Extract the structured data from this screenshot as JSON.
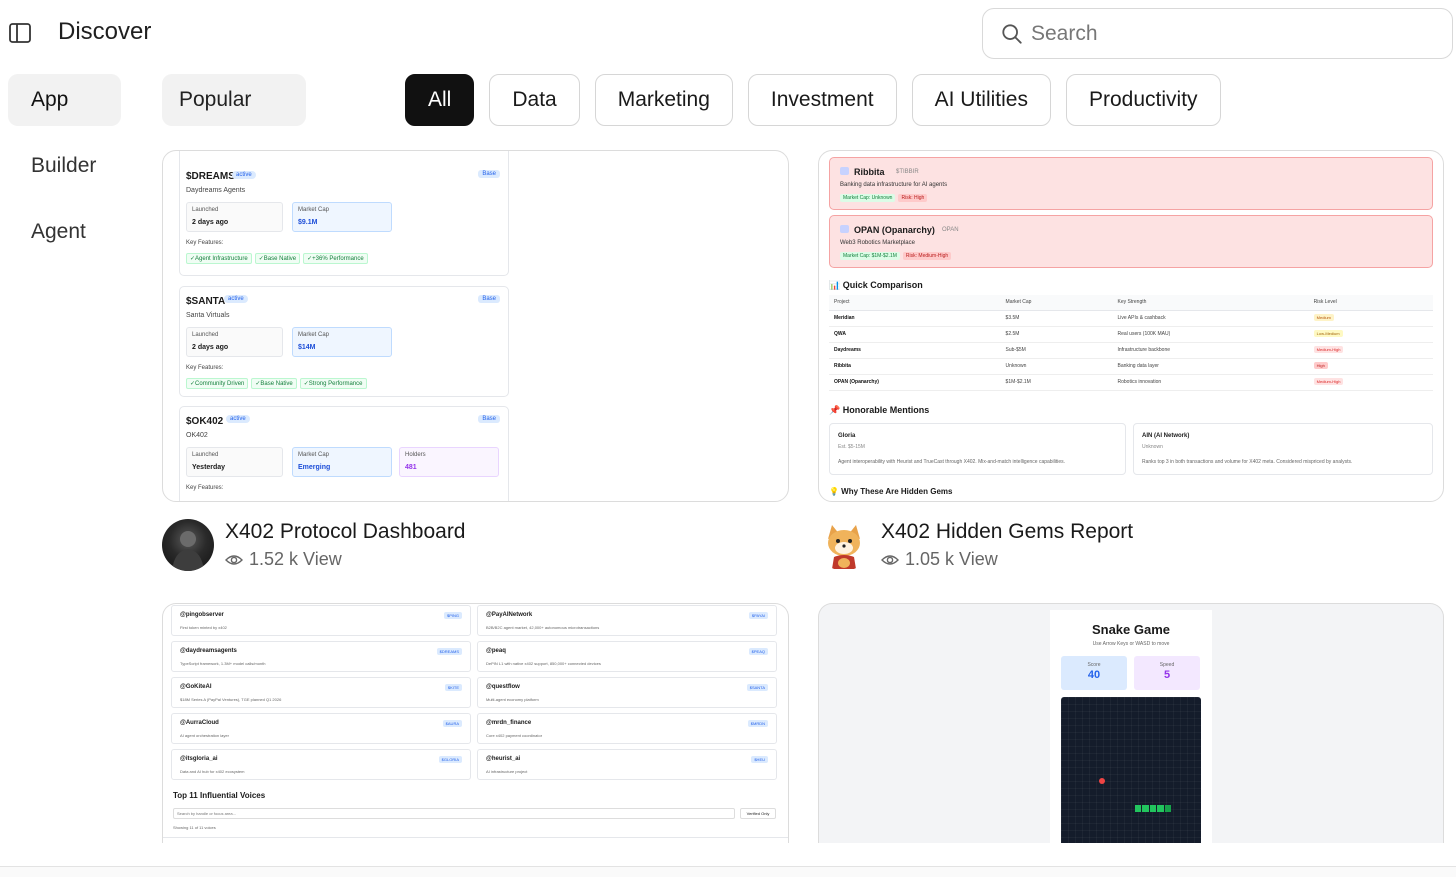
{
  "header": {
    "title": "Discover",
    "search_placeholder": "Search"
  },
  "nav": {
    "items": [
      {
        "label": "App"
      },
      {
        "label": "Builder"
      },
      {
        "label": "Agent"
      }
    ]
  },
  "sort": {
    "selected": "Popular"
  },
  "filters": [
    {
      "label": "All"
    },
    {
      "label": "Data"
    },
    {
      "label": "Marketing"
    },
    {
      "label": "Investment"
    },
    {
      "label": "AI Utilities"
    },
    {
      "label": "Productivity"
    }
  ],
  "cards": [
    {
      "title": "X402 Protocol Dashboard",
      "views": "1.52 k View",
      "preview": {
        "tokens": [
          {
            "symbol": "$DREAMS",
            "status": "active",
            "chain": "Base",
            "name": "Daydreams Agents",
            "launched_label": "Launched",
            "launched": "2 days ago",
            "mcap_label": "Market Cap",
            "mcap": "$9.1M",
            "features_label": "Key Features:",
            "features": [
              "✓Agent Infrastructure",
              "✓Base Native",
              "✓+36% Performance"
            ]
          },
          {
            "symbol": "$SANTA",
            "status": "active",
            "chain": "Base",
            "name": "Santa Virtuals",
            "launched_label": "Launched",
            "launched": "2 days ago",
            "mcap_label": "Market Cap",
            "mcap": "$14M",
            "features_label": "Key Features:",
            "features": [
              "✓Community Driven",
              "✓Base Native",
              "✓Strong Performance"
            ]
          },
          {
            "symbol": "$OK402",
            "status": "active",
            "chain": "Base",
            "name": "OK402",
            "launched_label": "Launched",
            "launched": "Yesterday",
            "mcap_label": "Market Cap",
            "mcap": "Emerging",
            "holders_label": "Holders",
            "holders": "481",
            "features_label": "Key Features:"
          }
        ]
      }
    },
    {
      "title": "X402 Hidden Gems Report",
      "views": "1.05 k View",
      "preview": {
        "risk_cards": [
          {
            "name": "Ribbita",
            "ticker": "$TIBBIR",
            "desc": "Banking data infrastructure for AI agents",
            "tags": [
              "Market Cap: Unknown",
              "Risk: High"
            ]
          },
          {
            "name": "OPAN (Opanarchy)",
            "ticker": "OPAN",
            "desc": "Web3 Robotics Marketplace",
            "tags": [
              "Market Cap: $1M-$2.1M",
              "Risk: Medium-High"
            ]
          }
        ],
        "comparison_title": "📊 Quick Comparison",
        "comparison_headers": [
          "Project",
          "Market Cap",
          "Key Strength",
          "Risk Level"
        ],
        "comparison_rows": [
          [
            "Meridian",
            "$3.5M",
            "Live APIs & cashback",
            "Medium"
          ],
          [
            "QWA",
            "$2.5M",
            "Real users (100K MAU)",
            "Low-Medium"
          ],
          [
            "Daydreams",
            "Sub-$5M",
            "Infrastructure backbone",
            "Medium-High"
          ],
          [
            "Ribbita",
            "Unknown",
            "Banking data layer",
            "High"
          ],
          [
            "OPAN (Opanarchy)",
            "$1M-$2.1M",
            "Robotics innovation",
            "Medium-High"
          ]
        ],
        "mentions_title": "📌 Honorable Mentions",
        "mentions": [
          {
            "name": "Gloria",
            "mcap": "Est. $5-15M",
            "desc": "Agent interoperability with Heurist and TrueCast through X402. Mix-and-match intelligence capabilities."
          },
          {
            "name": "AIN (AI Network)",
            "mcap": "Unknown",
            "desc": "Ranks top 3 in both transactions and volume for X402 meta. Considered mispriced by analysts."
          }
        ],
        "why_title": "💡 Why These Are Hidden Gems"
      }
    },
    {
      "preview": {
        "voices": [
          {
            "handle": "@pingobserver",
            "tag": "$PING",
            "desc": "First token minted by x402"
          },
          {
            "handle": "@PayAINetwork",
            "tag": "$PAYAI",
            "desc": "B2B/B2C agent market, 42,000+ autonomous microtransactions"
          },
          {
            "handle": "@daydreamsagents",
            "tag": "$DREAMS",
            "desc": "TypeScript framework, 1.3M+ model calls/month"
          },
          {
            "handle": "@peaq",
            "tag": "$PEAQ",
            "desc": "DePIN L1 with native x402 support, 850,000+ connected devices"
          },
          {
            "handle": "@GoKiteAI",
            "tag": "$KITE",
            "desc": "$18M Series A (PayPal Ventures), TGE planned Q1 2026"
          },
          {
            "handle": "@questflow",
            "tag": "$SANTA",
            "desc": "Multi-agent economy platform"
          },
          {
            "handle": "@AurraCloud",
            "tag": "$AURA",
            "desc": "AI agent orchestration layer"
          },
          {
            "handle": "@mrdn_finance",
            "tag": "$MRDN",
            "desc": "Core x402 payment coordinator"
          },
          {
            "handle": "@itsgloria_ai",
            "tag": "$GLORIA",
            "desc": "Data and AI hub for x402 ecosystem"
          },
          {
            "handle": "@heurist_ai",
            "tag": "$HEU",
            "desc": "AI infrastructure project"
          }
        ],
        "section_title": "Top 11 Influential Voices",
        "search_placeholder": "Search by handle or focus area...",
        "verified_label": "Verified Only",
        "showing": "Showing 11 of 11 voices"
      }
    },
    {
      "preview": {
        "game_title": "Snake Game",
        "game_subtitle": "Use Arrow Keys or WASD to move",
        "score_label": "Score",
        "score": "40",
        "speed_label": "Speed",
        "speed": "5"
      }
    }
  ],
  "colors": {
    "accent": "#111111",
    "pill_border": "#d6d6d6",
    "nav_active_bg": "#f2f2f2",
    "link_blue": "#2563eb"
  }
}
